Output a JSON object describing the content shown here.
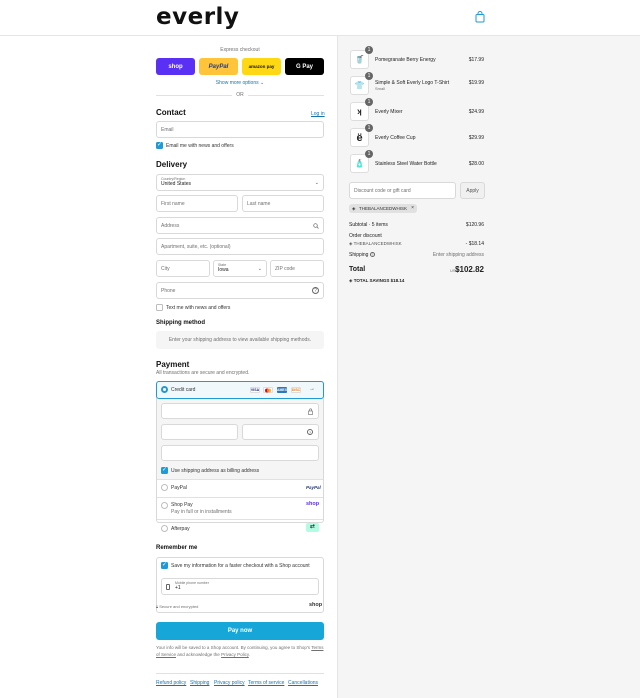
{
  "brand": {
    "logo": "everly",
    "bag_icon": "shopping-bag-icon"
  },
  "express": {
    "label": "Express checkout",
    "buttons": [
      {
        "label": "shop",
        "color": "#5a31f4"
      },
      {
        "label": "PayPal",
        "color": "#ffc439"
      },
      {
        "label": "amazon pay",
        "color": "#ffd814"
      },
      {
        "label": "G Pay",
        "color": "#000000"
      }
    ],
    "show_more": "Show more options ⌄",
    "or": "OR"
  },
  "contact": {
    "heading": "Contact",
    "login": "Log in",
    "email_placeholder": "Email",
    "email_news": "Email me with news and offers"
  },
  "delivery": {
    "heading": "Delivery",
    "country_label": "Country/Region",
    "country_value": "United States",
    "first_name": "First name",
    "last_name": "Last name",
    "address": "Address",
    "apartment": "Apartment, suite, etc. (optional)",
    "city": "City",
    "state_label": "State",
    "state_value": "Iowa",
    "zip": "ZIP code",
    "phone": "Phone",
    "text_news": "Text me with news and offers"
  },
  "shipping_method": {
    "heading": "Shipping method",
    "placeholder": "Enter your shipping address to view available shipping methods."
  },
  "payment": {
    "heading": "Payment",
    "subtitle": "All transactions are secure and encrypted.",
    "credit_card": "Credit card",
    "card_brands": [
      "VISA",
      "MC",
      "AMEX",
      "DISC"
    ],
    "more_cards": "+",
    "billing_same": "Use shipping address as billing address",
    "paypal": "PayPal",
    "paypal_logo": "PayPal",
    "shop_pay": "Shop Pay",
    "shop_pay_sub": "Pay in full or in installments",
    "shop_logo": "shop",
    "afterpay": "Afterpay",
    "afterpay_logo": "⇄"
  },
  "remember": {
    "heading": "Remember me",
    "save_info": "Save my information for a faster checkout with a Shop account",
    "mobile_label": "Mobile phone number",
    "mobile_value": "+1",
    "secure": "Secure and encrypted",
    "shop": "shop"
  },
  "pay_now": "Pay now",
  "legal": {
    "text": "Your info will be saved to a Shop account. By continuing, you agree to Shop's",
    "tos": "Terms of Service",
    "and": "and acknowledge the",
    "privacy": "Privacy Policy",
    "dot": "."
  },
  "footer": [
    "Refund policy",
    "Shipping",
    "Privacy policy",
    "Terms of service",
    "Cancellations"
  ],
  "cart": {
    "items": [
      {
        "name": "Pomegranate Berry Energy",
        "variant": "",
        "price": "$17.99",
        "qty": "1",
        "thumb": "🥤"
      },
      {
        "name": "Simple & Soft Everly Logo T-Shirt",
        "variant": "Small",
        "price": "$19.99",
        "qty": "1",
        "thumb": "👕"
      },
      {
        "name": "Everly Mixer",
        "variant": "",
        "price": "$24.99",
        "qty": "1",
        "thumb": "ʞ"
      },
      {
        "name": "Everly Coffee Cup",
        "variant": "",
        "price": "$29.99",
        "qty": "1",
        "thumb": "ë"
      },
      {
        "name": "Stainless Steel Water Bottle",
        "variant": "",
        "price": "$28.00",
        "qty": "1",
        "thumb": "🧴"
      }
    ],
    "discount_placeholder": "Discount code or gift card",
    "apply": "Apply",
    "code_tag": "THEBALANCEDWHISK",
    "subtotal_label": "Subtotal · 5 items",
    "subtotal": "$120.96",
    "order_discount": "Order discount",
    "discount_code": "THEBALANCEDWHISK",
    "discount_amount": "- $18.14",
    "shipping_label": "Shipping",
    "shipping_value": "Enter shipping address",
    "total_label": "Total",
    "currency": "USD",
    "total": "$102.82",
    "savings_label": "TOTAL SAVINGS",
    "savings": "$18.14"
  },
  "colors": {
    "accent": "#1f9ad6",
    "link": "#1773b0",
    "pay_button": "#16a7d8"
  }
}
